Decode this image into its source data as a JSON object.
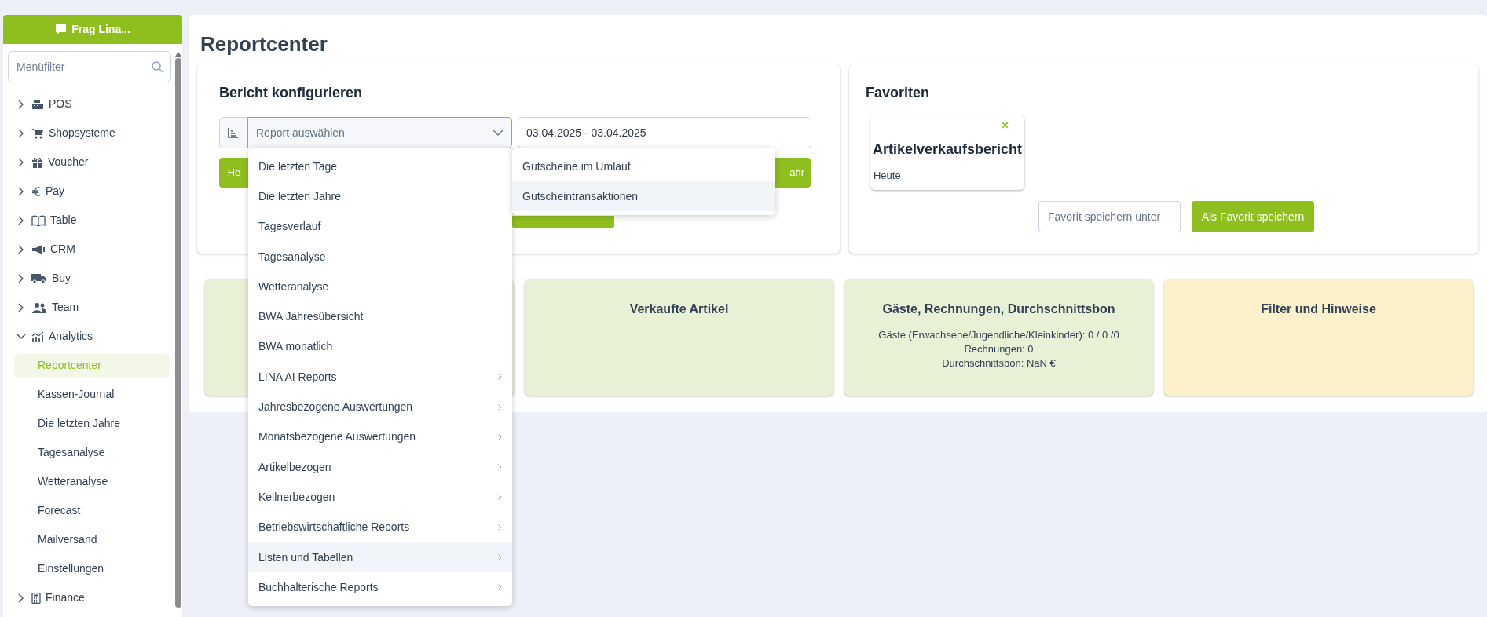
{
  "sidebar": {
    "ask_button": "Frag Lina...",
    "filter": {
      "placeholder": "Menüfilter"
    },
    "items": [
      {
        "label": "POS",
        "expanded": false
      },
      {
        "label": "Shopsysteme",
        "expanded": false
      },
      {
        "label": "Voucher",
        "expanded": false
      },
      {
        "label": "Pay",
        "expanded": false
      },
      {
        "label": "Table",
        "expanded": false
      },
      {
        "label": "CRM",
        "expanded": false
      },
      {
        "label": "Buy",
        "expanded": false
      },
      {
        "label": "Team",
        "expanded": false
      },
      {
        "label": "Analytics",
        "expanded": true,
        "children": [
          {
            "label": "Reportcenter",
            "selected": true
          },
          {
            "label": "Kassen-Journal",
            "selected": false
          },
          {
            "label": "Die letzten Jahre",
            "selected": false
          },
          {
            "label": "Tagesanalyse",
            "selected": false
          },
          {
            "label": "Wetteranalyse",
            "selected": false
          },
          {
            "label": "Forecast",
            "selected": false
          },
          {
            "label": "Mailversand",
            "selected": false
          },
          {
            "label": "Einstellungen",
            "selected": false
          }
        ]
      },
      {
        "label": "Finance",
        "expanded": false
      }
    ]
  },
  "page_title": "Reportcenter",
  "config": {
    "heading": "Bericht konfigurieren",
    "select": {
      "placeholder": "Report auswählen"
    },
    "date_range": "03.04.2025 - 03.04.2025",
    "buttons": [
      "He",
      "ahr"
    ],
    "menu": [
      {
        "label": "Die letzten Tage",
        "has_submenu": false,
        "selected": false
      },
      {
        "label": "Die letzten Jahre",
        "has_submenu": false,
        "selected": false
      },
      {
        "label": "Tagesverlauf",
        "has_submenu": false,
        "selected": false
      },
      {
        "label": "Tagesanalyse",
        "has_submenu": false,
        "selected": false
      },
      {
        "label": "Wetteranalyse",
        "has_submenu": false,
        "selected": false
      },
      {
        "label": "BWA Jahresübersicht",
        "has_submenu": false,
        "selected": false
      },
      {
        "label": "BWA monatlich",
        "has_submenu": false,
        "selected": false
      },
      {
        "label": "LINA AI Reports",
        "has_submenu": true,
        "selected": false
      },
      {
        "label": "Jahresbezogene Auswertungen",
        "has_submenu": true,
        "selected": false
      },
      {
        "label": "Monatsbezogene Auswertungen",
        "has_submenu": true,
        "selected": false
      },
      {
        "label": "Artikelbezogen",
        "has_submenu": true,
        "selected": false
      },
      {
        "label": "Kellnerbezogen",
        "has_submenu": true,
        "selected": false
      },
      {
        "label": "Betriebswirtschaftliche Reports",
        "has_submenu": true,
        "selected": false
      },
      {
        "label": "Listen und Tabellen",
        "has_submenu": true,
        "selected": true
      },
      {
        "label": "Buchhalterische Reports",
        "has_submenu": true,
        "selected": false
      }
    ],
    "submenu": [
      {
        "label": "Gutscheine im Umlauf",
        "selected": false
      },
      {
        "label": "Gutscheintransaktionen",
        "selected": true
      }
    ]
  },
  "favorites": {
    "heading": "Favoriten",
    "items": [
      {
        "title": "Artikelverkaufsbericht",
        "period": "Heute"
      }
    ],
    "name_field": {
      "placeholder": "Favorit speichern unter"
    },
    "save_button": "Als Favorit speichern"
  },
  "stat_cards": [
    {
      "color": "#e8f1d6"
    },
    {
      "title": "Verkaufte Artikel",
      "color": "#e8f1d6"
    },
    {
      "title": "Gäste, Rechnungen, Durchschnittsbon",
      "color": "#e8f1d6",
      "lines": [
        "Gäste (Erwachsene/Jugendliche/Kleinkinder): 0 / 0 /0",
        "Rechnungen: 0",
        "Durchschnittsbon: NaN €"
      ]
    },
    {
      "title": "Filter und Hinweise",
      "color": "#fdf1cc"
    }
  ]
}
